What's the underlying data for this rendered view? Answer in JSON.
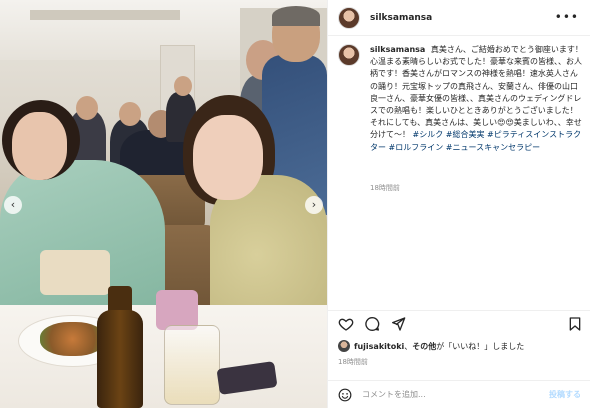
{
  "post": {
    "username": "silksamansa",
    "caption": {
      "username": "silksamansa",
      "text": "真美さん、ご結婚おめでとう御座います！心温まる素晴らしいお式でした！豪華な来賓の皆様、、お人柄です！香美さんがロマンスの神様を熱唱！速水英人さんの踊り！元宝塚トップの真飛さん、安蘭さん、俳優の山口良一さん、豪華女優の皆様、、真美さんのウェディングドレスでの熱唱も！楽しいひとときありがとうございました！それにしても、真美さんは、美しい😍😍美ましいわ、、幸せ分けて〜！",
      "hashtags": "#シルク #総合美実 #ピラティスインストラクター #ロルフライン #ニュースキャンセラピー"
    },
    "caption_time": "18時間前",
    "likes_user": "fujisakitoki",
    "likes_text_mid": "、",
    "likes_others": "その他",
    "likes_suffix": "が「いいね！」しました",
    "post_time": "18時間前",
    "comment_placeholder": "コメントを追加...",
    "post_button": "投稿する"
  },
  "photo": {
    "prev_arrow": "‹",
    "next_arrow": "›"
  },
  "icons": {
    "more": "•••"
  }
}
